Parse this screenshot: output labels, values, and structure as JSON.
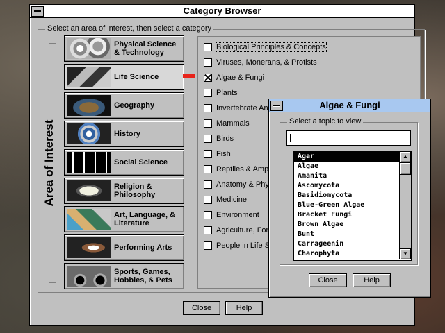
{
  "main_window": {
    "title": "Category Browser",
    "instruction": "Select an area of interest, then select a category",
    "area_heading": "Area of Interest",
    "areas": [
      {
        "label": "Physical Science & Technology",
        "thumb": "gears-image"
      },
      {
        "label": "Life Science",
        "thumb": "insect-image",
        "selected": true
      },
      {
        "label": "Geography",
        "thumb": "earth-image"
      },
      {
        "label": "History",
        "thumb": "globe-image"
      },
      {
        "label": "Social Science",
        "thumb": "evolution-image"
      },
      {
        "label": "Religion & Philosophy",
        "thumb": "scroll-image"
      },
      {
        "label": "Art, Language, & Literature",
        "thumb": "painting-image"
      },
      {
        "label": "Performing Arts",
        "thumb": "dancer-image"
      },
      {
        "label": "Sports, Games, Hobbies, & Pets",
        "thumb": "cyclist-image"
      }
    ],
    "categories": [
      {
        "label": "Biological Principles & Concepts",
        "checked": false
      },
      {
        "label": "Viruses, Monerans, & Protists",
        "checked": false
      },
      {
        "label": "Algae & Fungi",
        "checked": true
      },
      {
        "label": "Plants",
        "checked": false
      },
      {
        "label": "Invertebrate Animals",
        "checked": false
      },
      {
        "label": "Mammals",
        "checked": false
      },
      {
        "label": "Birds",
        "checked": false
      },
      {
        "label": "Fish",
        "checked": false
      },
      {
        "label": "Reptiles & Amphibians",
        "checked": false
      },
      {
        "label": "Anatomy & Physiology",
        "checked": false
      },
      {
        "label": "Medicine",
        "checked": false
      },
      {
        "label": "Environment",
        "checked": false
      },
      {
        "label": "Agriculture, Forestry",
        "checked": false
      },
      {
        "label": "People in Life Science",
        "checked": false
      }
    ],
    "close_label": "Close",
    "help_label": "Help"
  },
  "popup": {
    "title": "Algae & Fungi",
    "prompt": "Select a topic to view",
    "search_value": "",
    "topics": [
      "Agar",
      "Algae",
      "Amanita",
      "Ascomycota",
      "Basidiomycota",
      "Blue-Green Algae",
      "Bracket Fungi",
      "Brown Algae",
      "Bunt",
      "Carrageenin",
      "Charophyta"
    ],
    "selected_topic": "Agar",
    "close_label": "Close",
    "help_label": "Help",
    "title_color": "#a8c8f0"
  },
  "colors": {
    "window_face": "#c0c0c0",
    "connector": "#e8231a"
  }
}
